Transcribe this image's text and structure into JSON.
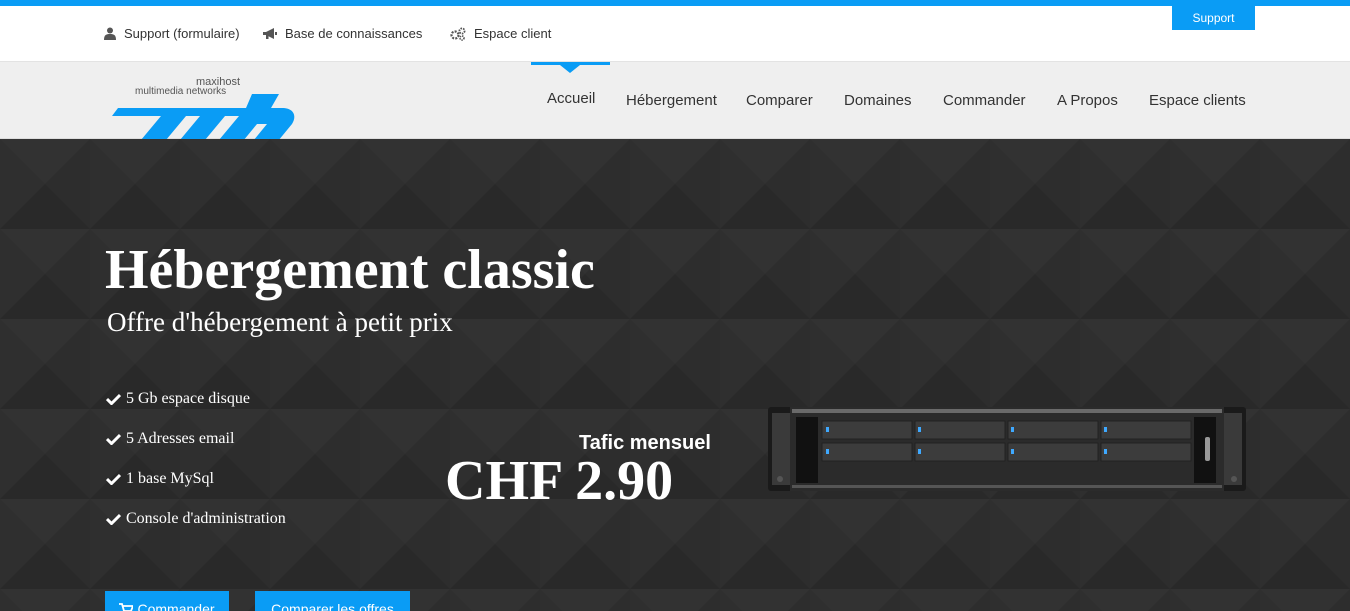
{
  "topbar": {
    "links": [
      {
        "label": "Support (formulaire)",
        "icon": "user-icon"
      },
      {
        "label": "Base de connaissances",
        "icon": "megaphone-icon"
      },
      {
        "label": "Espace client",
        "icon": "gears-icon"
      }
    ],
    "support_button": "Support"
  },
  "logo": {
    "line1": "maxihost",
    "line2": "multimedia networks",
    "mark": "mh"
  },
  "nav": {
    "items": [
      "Accueil",
      "Hébergement",
      "Comparer",
      "Domaines",
      "Commander",
      "A Propos",
      "Espace clients"
    ],
    "active": "Accueil"
  },
  "hero": {
    "title": "Hébergement classic",
    "subtitle": "Offre d'hébergement à petit prix",
    "features": [
      "5 Gb espace disque",
      "5 Adresses email",
      "1 base MySql",
      "Console d'administration"
    ],
    "price_label": "Tafic mensuel",
    "price": "CHF 2.90",
    "buttons": [
      {
        "label": "Commander",
        "icon": "cart-icon"
      },
      {
        "label": "Comparer les offres"
      }
    ]
  },
  "colors": {
    "accent": "#0a9cf5",
    "hero_bg": "#2d2d2d",
    "nav_bg": "#efefef"
  }
}
